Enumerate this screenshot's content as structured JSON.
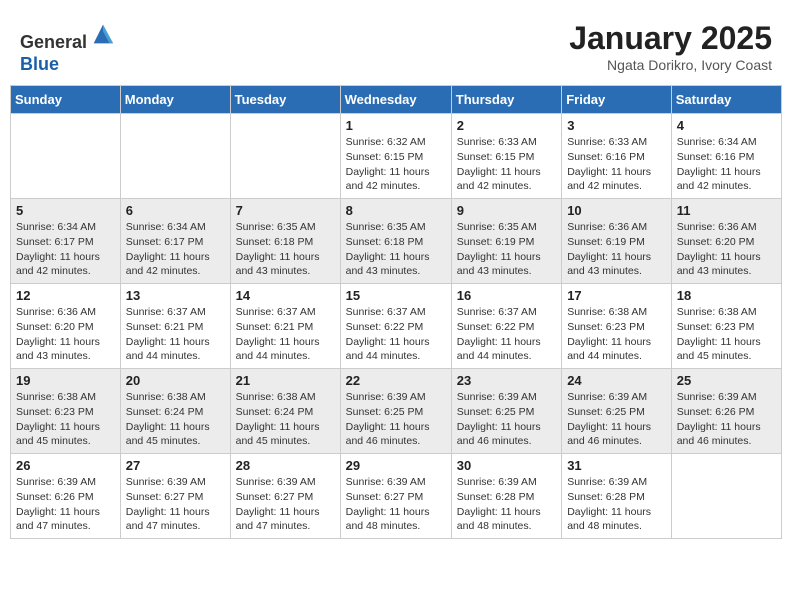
{
  "header": {
    "logo_line1": "General",
    "logo_line2": "Blue",
    "month": "January 2025",
    "location": "Ngata Dorikro, Ivory Coast"
  },
  "weekdays": [
    "Sunday",
    "Monday",
    "Tuesday",
    "Wednesday",
    "Thursday",
    "Friday",
    "Saturday"
  ],
  "weeks": [
    [
      {
        "day": "",
        "info": ""
      },
      {
        "day": "",
        "info": ""
      },
      {
        "day": "",
        "info": ""
      },
      {
        "day": "1",
        "info": "Sunrise: 6:32 AM\nSunset: 6:15 PM\nDaylight: 11 hours\nand 42 minutes."
      },
      {
        "day": "2",
        "info": "Sunrise: 6:33 AM\nSunset: 6:15 PM\nDaylight: 11 hours\nand 42 minutes."
      },
      {
        "day": "3",
        "info": "Sunrise: 6:33 AM\nSunset: 6:16 PM\nDaylight: 11 hours\nand 42 minutes."
      },
      {
        "day": "4",
        "info": "Sunrise: 6:34 AM\nSunset: 6:16 PM\nDaylight: 11 hours\nand 42 minutes."
      }
    ],
    [
      {
        "day": "5",
        "info": "Sunrise: 6:34 AM\nSunset: 6:17 PM\nDaylight: 11 hours\nand 42 minutes."
      },
      {
        "day": "6",
        "info": "Sunrise: 6:34 AM\nSunset: 6:17 PM\nDaylight: 11 hours\nand 42 minutes."
      },
      {
        "day": "7",
        "info": "Sunrise: 6:35 AM\nSunset: 6:18 PM\nDaylight: 11 hours\nand 43 minutes."
      },
      {
        "day": "8",
        "info": "Sunrise: 6:35 AM\nSunset: 6:18 PM\nDaylight: 11 hours\nand 43 minutes."
      },
      {
        "day": "9",
        "info": "Sunrise: 6:35 AM\nSunset: 6:19 PM\nDaylight: 11 hours\nand 43 minutes."
      },
      {
        "day": "10",
        "info": "Sunrise: 6:36 AM\nSunset: 6:19 PM\nDaylight: 11 hours\nand 43 minutes."
      },
      {
        "day": "11",
        "info": "Sunrise: 6:36 AM\nSunset: 6:20 PM\nDaylight: 11 hours\nand 43 minutes."
      }
    ],
    [
      {
        "day": "12",
        "info": "Sunrise: 6:36 AM\nSunset: 6:20 PM\nDaylight: 11 hours\nand 43 minutes."
      },
      {
        "day": "13",
        "info": "Sunrise: 6:37 AM\nSunset: 6:21 PM\nDaylight: 11 hours\nand 44 minutes."
      },
      {
        "day": "14",
        "info": "Sunrise: 6:37 AM\nSunset: 6:21 PM\nDaylight: 11 hours\nand 44 minutes."
      },
      {
        "day": "15",
        "info": "Sunrise: 6:37 AM\nSunset: 6:22 PM\nDaylight: 11 hours\nand 44 minutes."
      },
      {
        "day": "16",
        "info": "Sunrise: 6:37 AM\nSunset: 6:22 PM\nDaylight: 11 hours\nand 44 minutes."
      },
      {
        "day": "17",
        "info": "Sunrise: 6:38 AM\nSunset: 6:23 PM\nDaylight: 11 hours\nand 44 minutes."
      },
      {
        "day": "18",
        "info": "Sunrise: 6:38 AM\nSunset: 6:23 PM\nDaylight: 11 hours\nand 45 minutes."
      }
    ],
    [
      {
        "day": "19",
        "info": "Sunrise: 6:38 AM\nSunset: 6:23 PM\nDaylight: 11 hours\nand 45 minutes."
      },
      {
        "day": "20",
        "info": "Sunrise: 6:38 AM\nSunset: 6:24 PM\nDaylight: 11 hours\nand 45 minutes."
      },
      {
        "day": "21",
        "info": "Sunrise: 6:38 AM\nSunset: 6:24 PM\nDaylight: 11 hours\nand 45 minutes."
      },
      {
        "day": "22",
        "info": "Sunrise: 6:39 AM\nSunset: 6:25 PM\nDaylight: 11 hours\nand 46 minutes."
      },
      {
        "day": "23",
        "info": "Sunrise: 6:39 AM\nSunset: 6:25 PM\nDaylight: 11 hours\nand 46 minutes."
      },
      {
        "day": "24",
        "info": "Sunrise: 6:39 AM\nSunset: 6:25 PM\nDaylight: 11 hours\nand 46 minutes."
      },
      {
        "day": "25",
        "info": "Sunrise: 6:39 AM\nSunset: 6:26 PM\nDaylight: 11 hours\nand 46 minutes."
      }
    ],
    [
      {
        "day": "26",
        "info": "Sunrise: 6:39 AM\nSunset: 6:26 PM\nDaylight: 11 hours\nand 47 minutes."
      },
      {
        "day": "27",
        "info": "Sunrise: 6:39 AM\nSunset: 6:27 PM\nDaylight: 11 hours\nand 47 minutes."
      },
      {
        "day": "28",
        "info": "Sunrise: 6:39 AM\nSunset: 6:27 PM\nDaylight: 11 hours\nand 47 minutes."
      },
      {
        "day": "29",
        "info": "Sunrise: 6:39 AM\nSunset: 6:27 PM\nDaylight: 11 hours\nand 48 minutes."
      },
      {
        "day": "30",
        "info": "Sunrise: 6:39 AM\nSunset: 6:28 PM\nDaylight: 11 hours\nand 48 minutes."
      },
      {
        "day": "31",
        "info": "Sunrise: 6:39 AM\nSunset: 6:28 PM\nDaylight: 11 hours\nand 48 minutes."
      },
      {
        "day": "",
        "info": ""
      }
    ]
  ]
}
